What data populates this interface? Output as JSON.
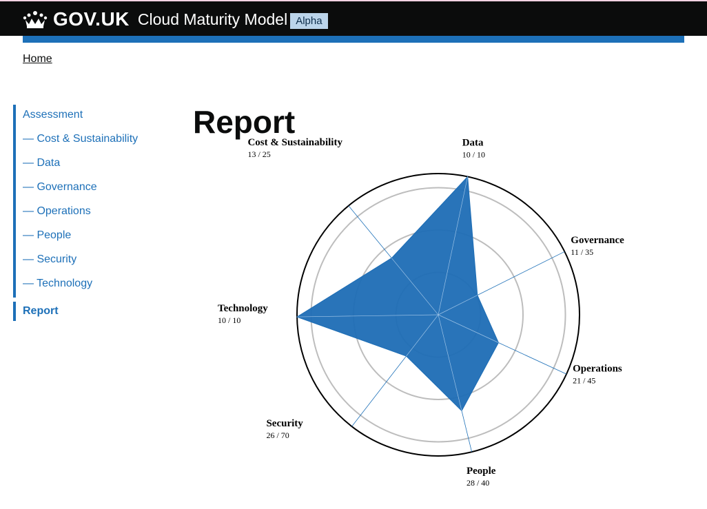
{
  "header": {
    "brand": "GOV.UK",
    "service_name": "Cloud Maturity Model",
    "phase_tag": "Alpha"
  },
  "breadcrumb": {
    "home": "Home"
  },
  "sidenav": {
    "assessment": "Assessment",
    "items": [
      {
        "label": "— Cost & Sustainability"
      },
      {
        "label": "— Data"
      },
      {
        "label": "— Governance"
      },
      {
        "label": "— Operations"
      },
      {
        "label": "— People"
      },
      {
        "label": "— Security"
      },
      {
        "label": "— Technology"
      }
    ],
    "report": "Report"
  },
  "page": {
    "title": "Report"
  },
  "colors": {
    "accent": "#1d70b8",
    "radar_fill": "#1d6db5",
    "header_bg": "#0b0c0c"
  },
  "chart_data": {
    "type": "radar",
    "max": 1,
    "axes": [
      {
        "name": "Data",
        "score_label": "10 / 10",
        "value": 1.0
      },
      {
        "name": "Governance",
        "score_label": "11 / 35",
        "value": 0.31
      },
      {
        "name": "Operations",
        "score_label": "21 / 45",
        "value": 0.47
      },
      {
        "name": "People",
        "score_label": "28 / 40",
        "value": 0.7
      },
      {
        "name": "Security",
        "score_label": "26 / 70",
        "value": 0.37
      },
      {
        "name": "Technology",
        "score_label": "10 / 10",
        "value": 1.0
      },
      {
        "name": "Cost & Sustainability",
        "score_label": "13 / 25",
        "value": 0.52
      }
    ]
  }
}
